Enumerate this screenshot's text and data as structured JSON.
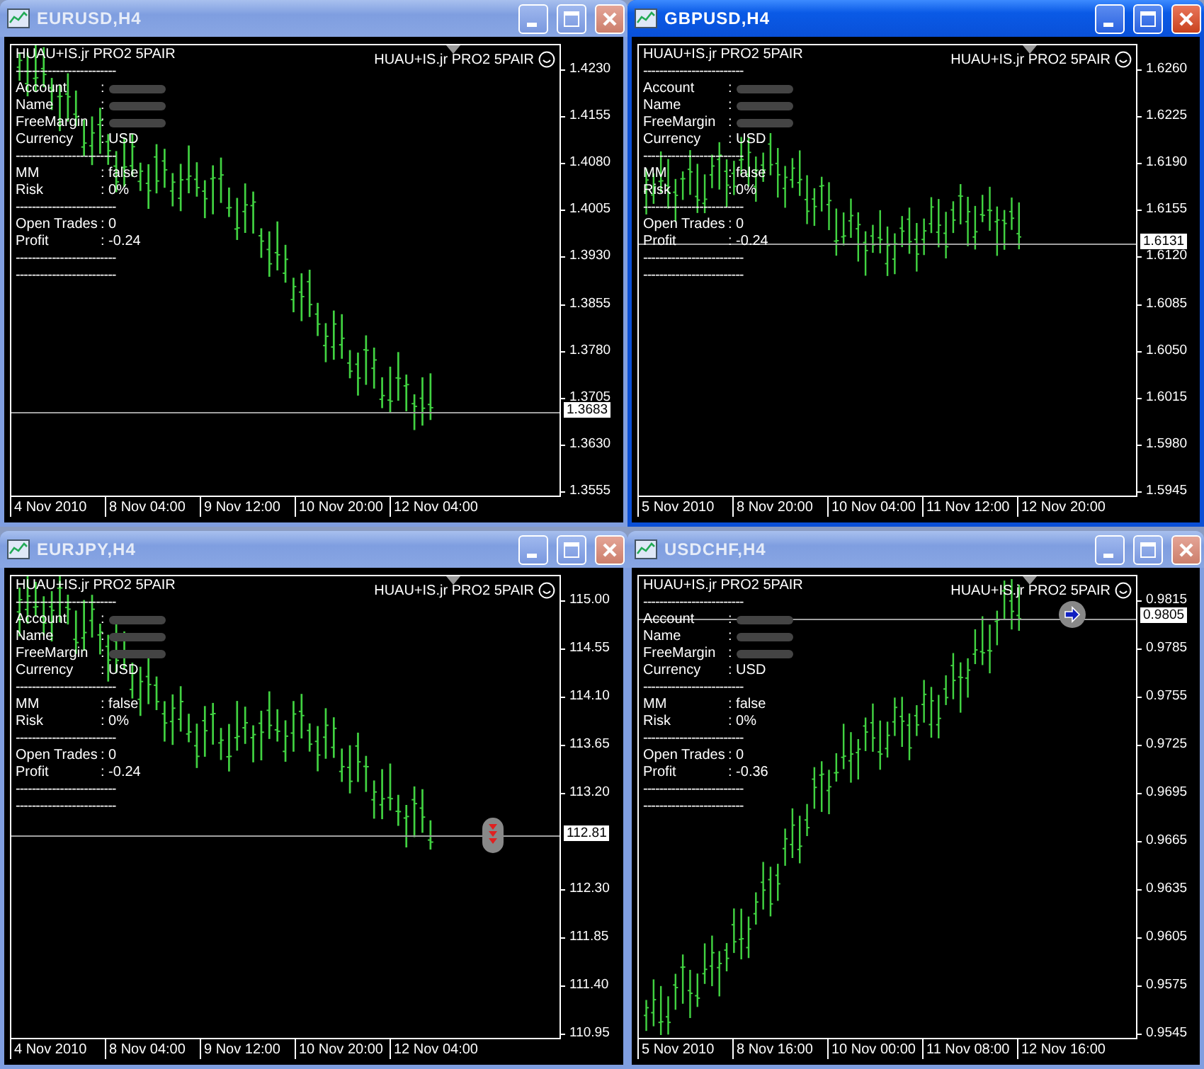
{
  "windows": [
    {
      "title": "EURUSD,H4",
      "selected": false,
      "indicator": "HUAU+IS.jr PRO2 5PAIR",
      "indicator_label": "HUAU+IS.jr PRO2 5PAIR",
      "info": [
        {
          "kind": "rule",
          "text": "-------------------------"
        },
        {
          "kind": "field",
          "label": "Account",
          "value": ":",
          "redacted": true
        },
        {
          "kind": "field",
          "label": "Name",
          "value": ":",
          "redacted": true
        },
        {
          "kind": "field",
          "label": "FreeMargin",
          "value": ":",
          "redacted": true
        },
        {
          "kind": "field",
          "label": "Currency",
          "value": ": USD",
          "redacted": false
        },
        {
          "kind": "rule",
          "text": "-------------------------"
        },
        {
          "kind": "field",
          "label": "MM",
          "value": ": false",
          "redacted": false
        },
        {
          "kind": "field",
          "label": "Risk",
          "value": ": 0%",
          "redacted": false
        },
        {
          "kind": "rule",
          "text": "-------------------------"
        },
        {
          "kind": "field",
          "label": "Open Trades",
          "value": ": 0",
          "redacted": false
        },
        {
          "kind": "field",
          "label": "Profit",
          "value": ": -0.24",
          "redacted": false
        },
        {
          "kind": "rule",
          "text": "-------------------------"
        },
        {
          "kind": "rule",
          "text": "-------------------------"
        }
      ],
      "price_labels": [
        "1.4230",
        "1.4155",
        "1.4080",
        "1.4005",
        "1.3930",
        "1.3855",
        "1.3780",
        "1.3705",
        "1.3630",
        "1.3555"
      ],
      "current_price": "1.3683",
      "time_labels": [
        "4 Nov 2010",
        "8 Nov 04:00",
        "9 Nov 12:00",
        "10 Nov 20:00",
        "12 Nov 04:00"
      ]
    },
    {
      "title": "GBPUSD,H4",
      "selected": true,
      "indicator": "HUAU+IS.jr PRO2 5PAIR",
      "indicator_label": "HUAU+IS.jr PRO2 5PAIR",
      "info": [
        {
          "kind": "rule",
          "text": "-------------------------"
        },
        {
          "kind": "field",
          "label": "Account",
          "value": ":",
          "redacted": true
        },
        {
          "kind": "field",
          "label": "Name",
          "value": ":",
          "redacted": true
        },
        {
          "kind": "field",
          "label": "FreeMargin",
          "value": ":",
          "redacted": true
        },
        {
          "kind": "field",
          "label": "Currency",
          "value": ": USD",
          "redacted": false
        },
        {
          "kind": "rule",
          "text": "-------------------------"
        },
        {
          "kind": "field",
          "label": "MM",
          "value": ": false",
          "redacted": false
        },
        {
          "kind": "field",
          "label": "Risk",
          "value": ": 0%",
          "redacted": false
        },
        {
          "kind": "rule",
          "text": "-------------------------"
        },
        {
          "kind": "field",
          "label": "Open Trades",
          "value": ": 0",
          "redacted": false
        },
        {
          "kind": "field",
          "label": "Profit",
          "value": ": -0.24",
          "redacted": false
        },
        {
          "kind": "rule",
          "text": "-------------------------"
        },
        {
          "kind": "rule",
          "text": "-------------------------"
        }
      ],
      "price_labels": [
        "1.6260",
        "1.6225",
        "1.6190",
        "1.6155",
        "1.6120",
        "1.6085",
        "1.6050",
        "1.6015",
        "1.5980",
        "1.5945"
      ],
      "current_price": "1.6131",
      "time_labels": [
        "5 Nov 2010",
        "8 Nov 20:00",
        "10 Nov 04:00",
        "11 Nov 12:00",
        "12 Nov 20:00"
      ]
    },
    {
      "title": "EURJPY,H4",
      "selected": false,
      "indicator": "HUAU+IS.jr PRO2 5PAIR",
      "indicator_label": "HUAU+IS.jr PRO2 5PAIR",
      "marker": {
        "kind": "stacked-arrows"
      },
      "info": [
        {
          "kind": "rule",
          "text": "-------------------------"
        },
        {
          "kind": "field",
          "label": "Account",
          "value": ":",
          "redacted": true
        },
        {
          "kind": "field",
          "label": "Name",
          "value": ":",
          "redacted": true
        },
        {
          "kind": "field",
          "label": "FreeMargin",
          "value": ":",
          "redacted": true
        },
        {
          "kind": "field",
          "label": "Currency",
          "value": ": USD",
          "redacted": false
        },
        {
          "kind": "rule",
          "text": "-------------------------"
        },
        {
          "kind": "field",
          "label": "MM",
          "value": ": false",
          "redacted": false
        },
        {
          "kind": "field",
          "label": "Risk",
          "value": ": 0%",
          "redacted": false
        },
        {
          "kind": "rule",
          "text": "-------------------------"
        },
        {
          "kind": "field",
          "label": "Open Trades",
          "value": ": 0",
          "redacted": false
        },
        {
          "kind": "field",
          "label": "Profit",
          "value": ": -0.24",
          "redacted": false
        },
        {
          "kind": "rule",
          "text": "-------------------------"
        },
        {
          "kind": "rule",
          "text": "-------------------------"
        }
      ],
      "price_labels": [
        "115.00",
        "114.55",
        "114.10",
        "113.65",
        "113.20",
        "112.30",
        "111.85",
        "111.40",
        "110.95"
      ],
      "current_price": "112.81",
      "time_labels": [
        "4 Nov 2010",
        "8 Nov 04:00",
        "9 Nov 12:00",
        "10 Nov 20:00",
        "12 Nov 04:00"
      ]
    },
    {
      "title": "USDCHF,H4",
      "selected": false,
      "indicator": "HUAU+IS.jr PRO2 5PAIR",
      "indicator_label": "HUAU+IS.jr PRO2 5PAIR",
      "marker": {
        "kind": "arrow"
      },
      "info": [
        {
          "kind": "rule",
          "text": "-------------------------"
        },
        {
          "kind": "field",
          "label": "Account",
          "value": ":",
          "redacted": true
        },
        {
          "kind": "field",
          "label": "Name",
          "value": ":",
          "redacted": true
        },
        {
          "kind": "field",
          "label": "FreeMargin",
          "value": ":",
          "redacted": true
        },
        {
          "kind": "field",
          "label": "Currency",
          "value": ": USD",
          "redacted": false
        },
        {
          "kind": "rule",
          "text": "-------------------------"
        },
        {
          "kind": "field",
          "label": "MM",
          "value": ": false",
          "redacted": false
        },
        {
          "kind": "field",
          "label": "Risk",
          "value": ": 0%",
          "redacted": false
        },
        {
          "kind": "rule",
          "text": "-------------------------"
        },
        {
          "kind": "field",
          "label": "Open Trades",
          "value": ": 0",
          "redacted": false
        },
        {
          "kind": "field",
          "label": "Profit",
          "value": ": -0.36",
          "redacted": false
        },
        {
          "kind": "rule",
          "text": "-------------------------"
        },
        {
          "kind": "rule",
          "text": "-------------------------"
        }
      ],
      "price_labels": [
        "0.9815",
        "0.9785",
        "0.9755",
        "0.9725",
        "0.9695",
        "0.9665",
        "0.9635",
        "0.9605",
        "0.9575",
        "0.9545"
      ],
      "current_price": "0.9805",
      "time_labels": [
        "5 Nov 2010",
        "8 Nov 16:00",
        "10 Nov 00:00",
        "11 Nov 08:00",
        "12 Nov 16:00"
      ]
    }
  ]
}
